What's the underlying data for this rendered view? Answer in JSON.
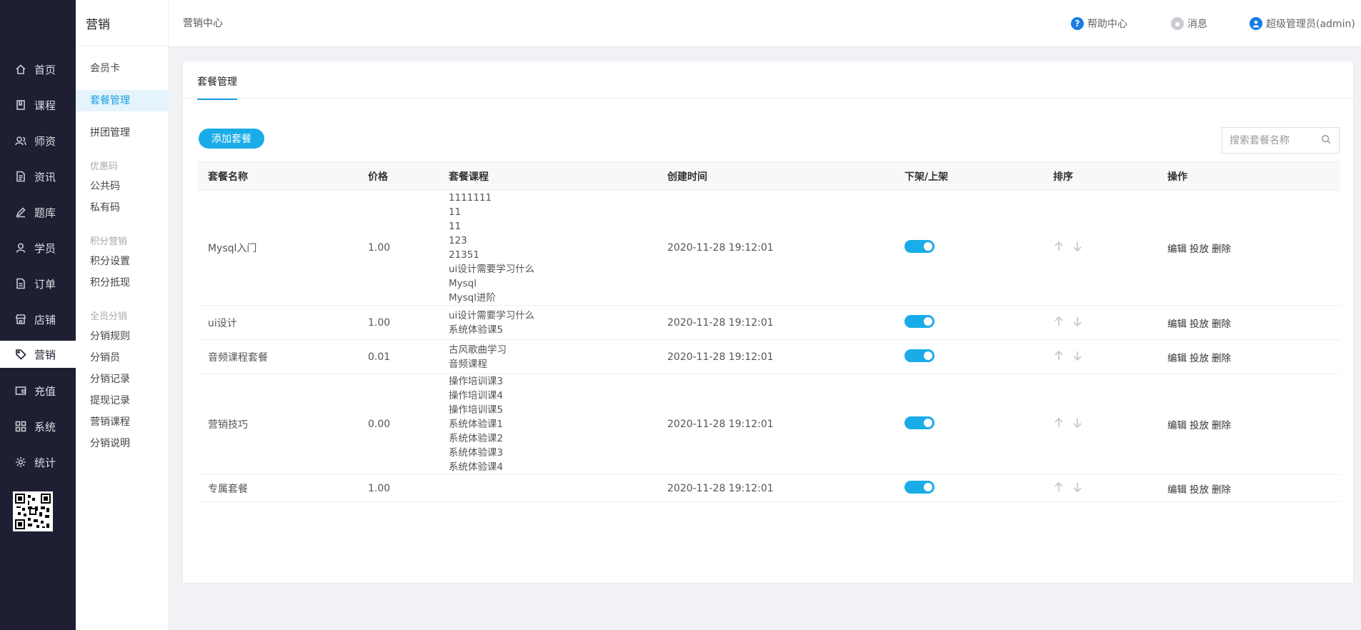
{
  "sidebar": {
    "items": [
      {
        "label": "首页",
        "icon": "home-icon"
      },
      {
        "label": "课程",
        "icon": "book-icon"
      },
      {
        "label": "师资",
        "icon": "teachers-icon"
      },
      {
        "label": "资讯",
        "icon": "news-icon"
      },
      {
        "label": "题库",
        "icon": "pen-icon"
      },
      {
        "label": "学员",
        "icon": "user-icon"
      },
      {
        "label": "订单",
        "icon": "order-icon"
      },
      {
        "label": "店铺",
        "icon": "shop-icon"
      },
      {
        "label": "营销",
        "icon": "tag-icon",
        "active": true
      },
      {
        "label": "充值",
        "icon": "wallet-icon"
      },
      {
        "label": "系统",
        "icon": "grid-icon"
      },
      {
        "label": "统计",
        "icon": "gear-icon"
      }
    ]
  },
  "submenu": {
    "title": "营销",
    "items": {
      "member_card": "会员卡",
      "package_mgmt": "套餐管理",
      "group_mgmt": "拼团管理",
      "public_code": "公共码",
      "private_code": "私有码",
      "points_settings": "积分设置",
      "points_deduct": "积分抵现",
      "dist_rules": "分销规则",
      "distributors": "分销员",
      "dist_records": "分销记录",
      "withdraw_records": "提现记录",
      "marketing_courses": "营销课程",
      "dist_desc": "分销说明"
    },
    "groups": {
      "coupon": "优惠码",
      "points": "积分营销",
      "distribution": "全员分销"
    }
  },
  "header": {
    "breadcrumb": "营销中心",
    "help": "帮助中心",
    "messages": "消息",
    "user": "超级管理员(admin)",
    "accent": "#1aa0e0"
  },
  "main": {
    "tab": "套餐管理",
    "add_button": "添加套餐",
    "search_placeholder": "搜索套餐名称",
    "columns": [
      "套餐名称",
      "价格",
      "套餐课程",
      "创建时间",
      "下架/上架",
      "排序",
      "操作"
    ],
    "actions": {
      "edit": "编辑",
      "deliver": "投放",
      "delete": "删除"
    },
    "rows": [
      {
        "name": "Mysql入门",
        "price": "1.00",
        "courses": [
          "1111111",
          "11",
          "11",
          "123",
          "21351",
          "ui设计需要学习什么",
          "Mysql",
          "Mysql进阶"
        ],
        "created": "2020-11-28 19:12:01",
        "on_shelf": true
      },
      {
        "name": "ui设计",
        "price": "1.00",
        "courses": [
          "ui设计需要学习什么",
          "系统体验课5"
        ],
        "created": "2020-11-28 19:12:01",
        "on_shelf": true
      },
      {
        "name": "音频课程套餐",
        "price": "0.01",
        "courses": [
          "古风歌曲学习",
          "音频课程"
        ],
        "created": "2020-11-28 19:12:01",
        "on_shelf": true
      },
      {
        "name": "营销技巧",
        "price": "0.00",
        "courses": [
          "操作培训课3",
          "操作培训课4",
          "操作培训课5",
          "系统体验课1",
          "系统体验课2",
          "系统体验课3",
          "系统体验课4"
        ],
        "created": "2020-11-28 19:12:01",
        "on_shelf": true
      },
      {
        "name": "专属套餐",
        "price": "1.00",
        "courses": [],
        "created": "2020-11-28 19:12:01",
        "on_shelf": true
      }
    ]
  }
}
